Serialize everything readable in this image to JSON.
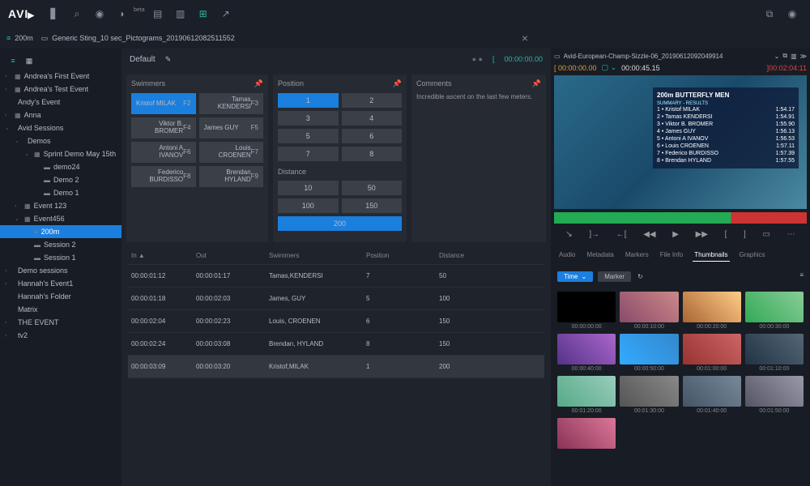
{
  "logo": "AVI",
  "breadcrumb": {
    "session": "200m",
    "clip": "Generic Sting_10 sec_Pictograms_20190612082511552"
  },
  "defaultTab": "Default",
  "sidebar": [
    {
      "label": "Andrea's First Event",
      "chev": "›",
      "ico": "▦",
      "ind": ""
    },
    {
      "label": "Andrea's Test Event",
      "chev": "›",
      "ico": "▦",
      "ind": ""
    },
    {
      "label": "Andy's Event",
      "chev": "",
      "ico": "",
      "ind": ""
    },
    {
      "label": "Anna",
      "chev": "›",
      "ico": "▦",
      "ind": ""
    },
    {
      "label": "Avid Sessions",
      "chev": "⌄",
      "ico": "",
      "ind": ""
    },
    {
      "label": "Demos",
      "chev": "⌄",
      "ico": "",
      "ind": "ind1"
    },
    {
      "label": "Sprint Demo May 15th",
      "chev": "⌄",
      "ico": "▦",
      "ind": "ind2"
    },
    {
      "label": "demo24",
      "chev": "",
      "ico": "▬",
      "ind": "ind3"
    },
    {
      "label": "Demo 2",
      "chev": "",
      "ico": "▬",
      "ind": "ind3"
    },
    {
      "label": "Demo 1",
      "chev": "",
      "ico": "▬",
      "ind": "ind3"
    },
    {
      "label": "Event 123",
      "chev": "›",
      "ico": "▦",
      "ind": "ind1"
    },
    {
      "label": "Event456",
      "chev": "⌄",
      "ico": "▦",
      "ind": "ind1"
    },
    {
      "label": "200m",
      "chev": "",
      "ico": "≡",
      "ind": "ind2",
      "sel": true
    },
    {
      "label": "Session 2",
      "chev": "",
      "ico": "▬",
      "ind": "ind2"
    },
    {
      "label": "Session 1",
      "chev": "",
      "ico": "▬",
      "ind": "ind2"
    },
    {
      "label": "Demo sessions",
      "chev": "›",
      "ico": "",
      "ind": ""
    },
    {
      "label": "Hannah's Event1",
      "chev": "›",
      "ico": "",
      "ind": ""
    },
    {
      "label": "Hannah's Folder",
      "chev": "",
      "ico": "",
      "ind": ""
    },
    {
      "label": "Matrix",
      "chev": "",
      "ico": "",
      "ind": ""
    },
    {
      "label": "THE EVENT",
      "chev": "›",
      "ico": "",
      "ind": ""
    },
    {
      "label": "tv2",
      "chev": "›",
      "ico": "",
      "ind": ""
    }
  ],
  "panels": {
    "swimmers": {
      "title": "Swimmers",
      "items": [
        {
          "name": "Kristof\nMILAK",
          "fn": "F2",
          "sel": true
        },
        {
          "name": "Tamas\nKENDERSI",
          "fn": "F3"
        },
        {
          "name": "Viktor\nB. BROMER",
          "fn": "F4"
        },
        {
          "name": "James\nGUY",
          "fn": "F5"
        },
        {
          "name": "Antoni\nA IVANOV",
          "fn": "F6"
        },
        {
          "name": "Louis\nCROENEN",
          "fn": "F7"
        },
        {
          "name": "Federico\nBURDISSO",
          "fn": "F8"
        },
        {
          "name": "Brendan\nHYLAND",
          "fn": "F9"
        }
      ]
    },
    "position": {
      "title": "Position",
      "items": [
        "1",
        "2",
        "3",
        "4",
        "5",
        "6",
        "7",
        "8"
      ]
    },
    "distance": {
      "title": "Distance",
      "items": [
        "10",
        "50",
        "100",
        "150",
        "200"
      ]
    },
    "comments": {
      "title": "Comments",
      "text": "Incredible ascent on the last few meters."
    }
  },
  "tableHeaders": [
    "In ▲",
    "Out",
    "Swimmers",
    "Position",
    "Distance"
  ],
  "tableRows": [
    [
      "00:00:01:12",
      "00:00:01:17",
      "Tamas,KENDERSI",
      "7",
      "50"
    ],
    [
      "00:00:01:18",
      "00:00:02:03",
      "James, GUY",
      "5",
      "100"
    ],
    [
      "00:00:02:04",
      "00:00:02:23",
      "Louis, CROENEN",
      "6",
      "150"
    ],
    [
      "00:00:02:24",
      "00:00:03:08",
      "Brendan, HYLAND",
      "8",
      "150"
    ],
    [
      "00:00:03:09",
      "00:00:03:20",
      "Kristof,MILAK",
      "1",
      "200"
    ]
  ],
  "player": {
    "clipName": "Avid-European-Champ-Sizzle-06_20190612092049914",
    "tcIn": "00:00:00.00",
    "tcDur": "00:00:45.15",
    "tcTotal": "00:02:04:11",
    "overlayTitle": "200m BUTTERFLY MEN",
    "overlaySub": "SUMMARY - RESULTS",
    "results": [
      {
        "pos": "1",
        "name": "Kristof MILAK",
        "time": "1:54.17"
      },
      {
        "pos": "2",
        "name": "Tamas KENDERSI",
        "time": "1:54.91"
      },
      {
        "pos": "3",
        "name": "Viktor B. BROMER",
        "time": "1:55.90"
      },
      {
        "pos": "4",
        "name": "James GUY",
        "time": "1:56.13"
      },
      {
        "pos": "5",
        "name": "Antoni A IVANOV",
        "time": "1:56.53"
      },
      {
        "pos": "6",
        "name": "Louis CROENEN",
        "time": "1:57.11"
      },
      {
        "pos": "7",
        "name": "Federico BURDISSO",
        "time": "1:57.39"
      },
      {
        "pos": "8",
        "name": "Brendan HYLAND",
        "time": "1:57.55"
      }
    ]
  },
  "tabs": [
    "Audio",
    "Metadata",
    "Markers",
    "File Info",
    "Thumbnails",
    "Graphics"
  ],
  "filterChips": {
    "time": "Time",
    "marker": "Marker"
  },
  "thumbs": [
    {
      "tc": "00:00:00:00",
      "bg": "bg0"
    },
    {
      "tc": "00:00:10:00",
      "bg": "bg1"
    },
    {
      "tc": "00:00:20:00",
      "bg": "bg2"
    },
    {
      "tc": "00:00:30:00",
      "bg": "bg3"
    },
    {
      "tc": "00:00:40:00",
      "bg": "bg4"
    },
    {
      "tc": "00:00:50:00",
      "bg": "bg5"
    },
    {
      "tc": "00:01:00:00",
      "bg": "bg6"
    },
    {
      "tc": "00:01:10:00",
      "bg": "bg7"
    },
    {
      "tc": "00:01:20:00",
      "bg": "bg8"
    },
    {
      "tc": "00:01:30:00",
      "bg": "bg9"
    },
    {
      "tc": "00:01:40:00",
      "bg": "bg10"
    },
    {
      "tc": "00:01:50:00",
      "bg": "bg11"
    },
    {
      "tc": "",
      "bg": "bg12"
    }
  ]
}
